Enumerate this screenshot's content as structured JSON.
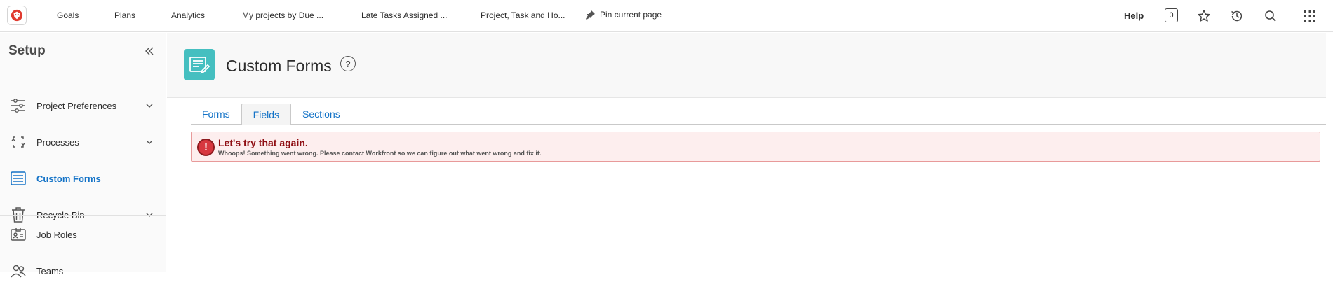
{
  "topnav": {
    "items": [
      "Goals",
      "Plans",
      "Analytics",
      "My projects by Due ...",
      "Late Tasks Assigned ...",
      "Project, Task and Ho..."
    ],
    "pin_label": "Pin current page",
    "help_label": "Help",
    "notification_count": "0"
  },
  "sidebar": {
    "title": "Setup",
    "items": [
      {
        "label": "Project Preferences",
        "icon": "sliders-icon",
        "expandable": true
      },
      {
        "label": "Processes",
        "icon": "process-icon",
        "expandable": true
      },
      {
        "label": "Custom Forms",
        "icon": "form-list-icon",
        "expandable": false,
        "active": true
      },
      {
        "label": "Recycle Bin",
        "icon": "trash-icon",
        "expandable": true
      },
      {
        "label": "Job Roles",
        "icon": "id-card-icon",
        "expandable": false
      },
      {
        "label": "Teams",
        "icon": "people-icon",
        "expandable": false
      }
    ]
  },
  "header": {
    "title": "Custom Forms",
    "help_symbol": "?"
  },
  "tabs": [
    {
      "label": "Forms",
      "active": false
    },
    {
      "label": "Fields",
      "active": true
    },
    {
      "label": "Sections",
      "active": false
    }
  ],
  "error": {
    "icon_symbol": "!",
    "title": "Let's try that again.",
    "message": "Whoops! Something went wrong. Please contact Workfront so we can figure out what went wrong and fix it."
  },
  "colors": {
    "accent_blue": "#1473c7",
    "form_tile": "#45bfc0",
    "error_red": "#d7373f",
    "logo_red": "#e03a2f"
  }
}
